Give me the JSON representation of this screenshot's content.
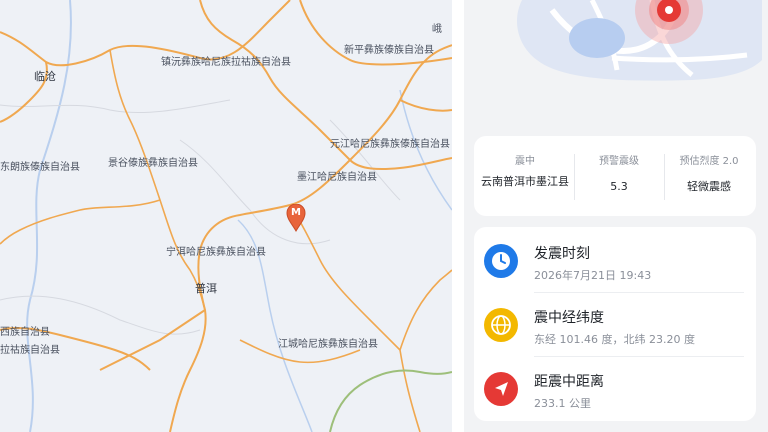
{
  "map": {
    "places": [
      {
        "id": "lincang",
        "label": "临沧"
      },
      {
        "id": "zhenyuan",
        "label": "镇沅彝族哈尼族拉祜族自治县"
      },
      {
        "id": "xinping",
        "label": "新平彝族傣族自治县"
      },
      {
        "id": "yuanjiang",
        "label": "元江哈尼族彝族傣族自治县"
      },
      {
        "id": "shuangjiang",
        "label": "东朗族傣族自治县"
      },
      {
        "id": "jinggu",
        "label": "景谷傣族彝族自治县"
      },
      {
        "id": "mojiang",
        "label": "墨江哈尼族自治县"
      },
      {
        "id": "ninger",
        "label": "宁洱哈尼族彝族自治县"
      },
      {
        "id": "puer",
        "label": "普洱"
      },
      {
        "id": "lancang",
        "label": "西族自治县"
      },
      {
        "id": "menglian",
        "label": "拉祜族自治县"
      },
      {
        "id": "jiangcheng",
        "label": "江城哈尼族彝族自治县"
      },
      {
        "id": "edge",
        "label": "峨"
      }
    ],
    "marker_letter": "M"
  },
  "info": {
    "epicenter_label": "震中",
    "epicenter_value": "云南普洱市墨江县",
    "warning_label": "预警震级",
    "warning_value": "5.3",
    "intensity_label": "预估烈度 2.0",
    "intensity_value": "轻微震感"
  },
  "details": [
    {
      "title": "发震时刻",
      "value": "2026年7月21日 19:43",
      "icon": "clock-icon",
      "color": "#1f7ae8"
    },
    {
      "title": "震中经纬度",
      "value": "东经 101.46 度，北纬 23.20 度",
      "icon": "globe-icon",
      "color": "#f3b800"
    },
    {
      "title": "距震中距离",
      "value": "233.1 公里",
      "icon": "location-arrow-icon",
      "color": "#e53935"
    }
  ]
}
